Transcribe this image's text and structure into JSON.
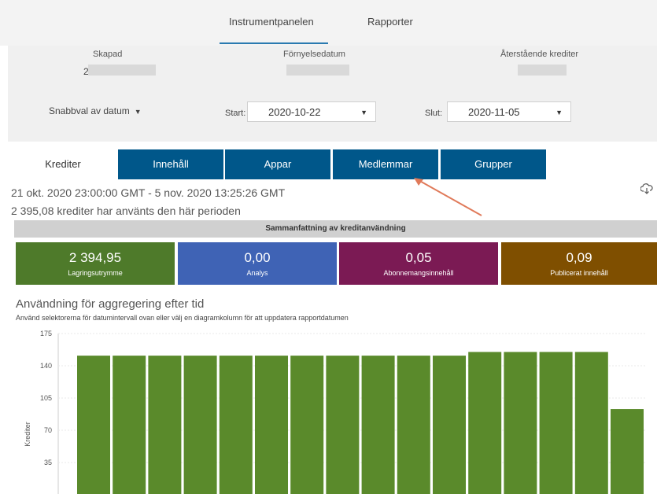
{
  "nav": {
    "tabs": [
      "Instrumentpanelen",
      "Rapporter"
    ]
  },
  "info": {
    "created_label": "Skapad",
    "created_value_partial": "2",
    "renewal_label": "Förnyelsedatum",
    "remaining_label": "Återstående krediter"
  },
  "filters": {
    "quick_label": "Snabbval av datum",
    "start_label": "Start:",
    "start_value": "2020-10-22",
    "end_label": "Slut:",
    "end_value": "2020-11-05"
  },
  "tabs": [
    "Krediter",
    "Innehåll",
    "Appar",
    "Medlemmar",
    "Grupper"
  ],
  "period_text": "21 okt. 2020 23:00:00 GMT - 5 nov. 2020 13:25:26 GMT",
  "used_text": "2 395,08 krediter har använts den här perioden",
  "summary_title": "Sammanfattning av kreditanvändning",
  "tiles": [
    {
      "value": "2 394,95",
      "label": "Lagringsutrymme",
      "color": "#4e7a2a"
    },
    {
      "value": "0,00",
      "label": "Analys",
      "color": "#3f63b5"
    },
    {
      "value": "0,05",
      "label": "Abonnemangsinnehåll",
      "color": "#7b1a54"
    },
    {
      "value": "0,09",
      "label": "Publicerat innehåll",
      "color": "#7f4f00"
    }
  ],
  "chart_title": "Användning för aggregering efter tid",
  "chart_subtitle": "Använd selektorerna för datumintervall ovan eller välj en diagramkolumn för att uppdatera rapportdatumen",
  "chart_data": {
    "type": "bar",
    "ylabel": "Krediter",
    "yticks": [
      35,
      70,
      105,
      140,
      175
    ],
    "ylim": [
      0,
      175
    ],
    "values": [
      151,
      151,
      151,
      151,
      151,
      151,
      151,
      151,
      151,
      151,
      151,
      155,
      155,
      155,
      155,
      93
    ],
    "color": "#5a8a2b",
    "grid": true
  },
  "colors": {
    "tab_blue": "#00578a",
    "accent_line": "#2a7ab0",
    "annotation_arrow": "#e07a5a"
  }
}
